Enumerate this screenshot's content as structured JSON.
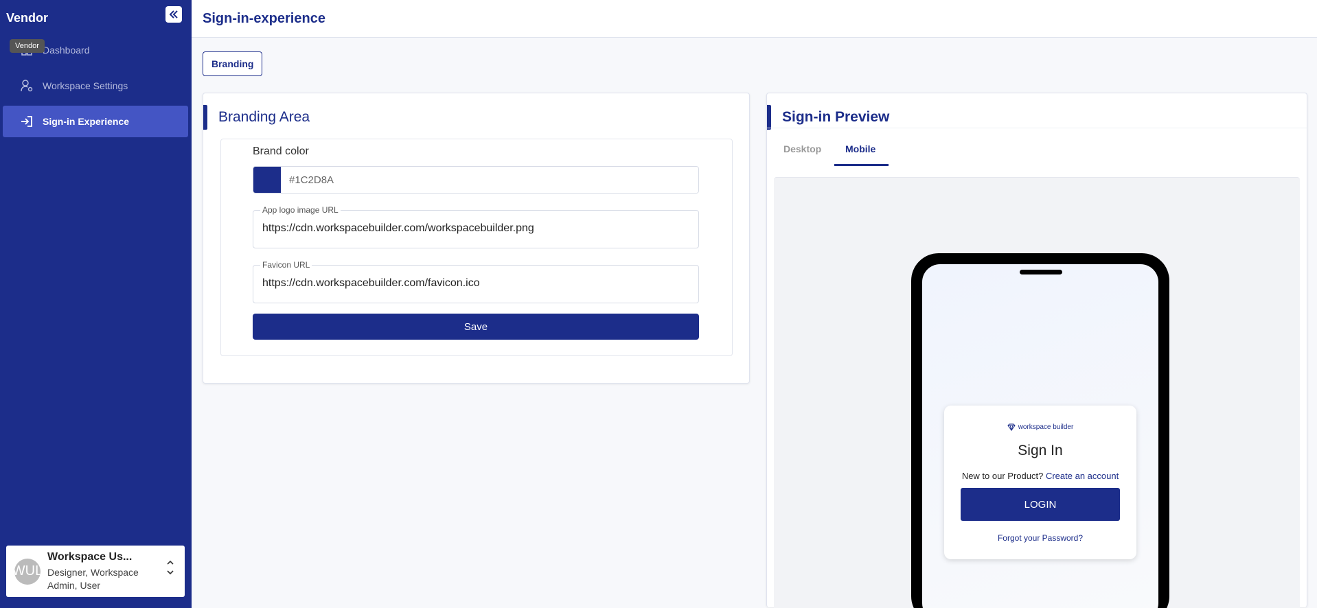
{
  "colors": {
    "primary": "#1C2D8A",
    "active_nav": "#4455C4",
    "background": "#F7F8FB"
  },
  "sidebar": {
    "brand": "Vendor",
    "tooltip": "Vendor",
    "items": [
      {
        "label": "Dashboard",
        "icon": "grid-icon"
      },
      {
        "label": "Workspace Settings",
        "icon": "user-settings-icon"
      },
      {
        "label": "Sign-in Experience",
        "icon": "sign-in-icon",
        "active": true
      }
    ],
    "user": {
      "initials": "WUL",
      "name": "Workspace Us...",
      "roles": "Designer, Workspace Admin, User"
    }
  },
  "header": {
    "title": "Sign-in-experience"
  },
  "tabs": {
    "branding": "Branding"
  },
  "branding": {
    "heading": "Branding Area",
    "brand_color_label": "Brand color",
    "brand_color_value": "#1C2D8A",
    "logo_url_label": "App logo image URL",
    "logo_url_value": "https://cdn.workspacebuilder.com/workspacebuilder.png",
    "favicon_label": "Favicon URL",
    "favicon_value": "https://cdn.workspacebuilder.com/favicon.ico",
    "save_label": "Save"
  },
  "preview": {
    "heading": "Sign-in Preview",
    "tab_desktop": "Desktop",
    "tab_mobile": "Mobile",
    "active_tab": "Mobile",
    "logo_text": "workspace builder",
    "signin_title": "Sign In",
    "new_text": "New to our Product?",
    "create_link": "Create an account",
    "login_label": "LOGIN",
    "forgot_link": "Forgot your Password?"
  }
}
